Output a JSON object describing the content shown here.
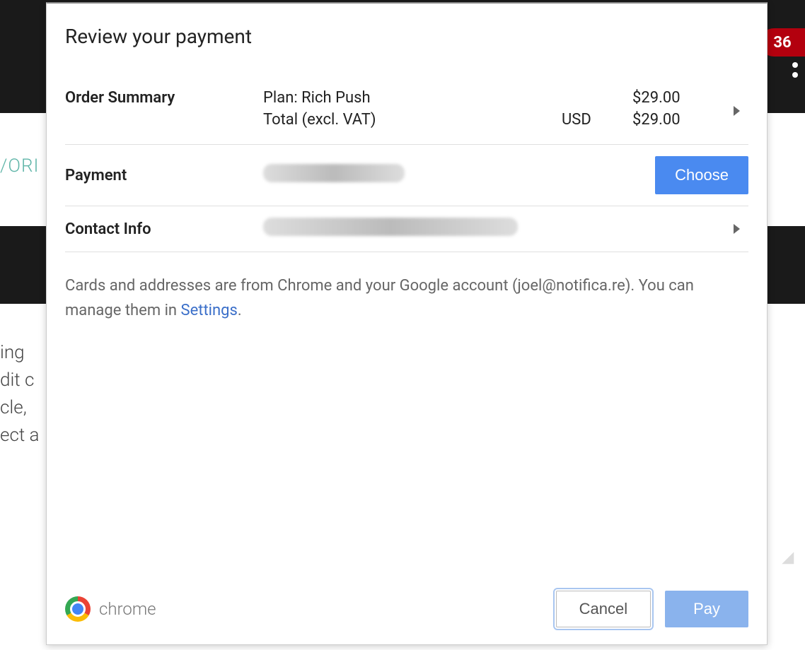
{
  "background": {
    "word_fragment": "/ORI",
    "text_lines": [
      "ing",
      "dit c",
      "cle,",
      "ect a"
    ],
    "badge_count": "36"
  },
  "modal": {
    "title": "Review your payment",
    "order_summary": {
      "label": "Order Summary",
      "rows": [
        {
          "desc": "Plan: Rich Push",
          "currency": "",
          "amount": "$29.00"
        },
        {
          "desc": "Total (excl. VAT)",
          "currency": "USD",
          "amount": "$29.00"
        }
      ]
    },
    "payment": {
      "label": "Payment",
      "choose_label": "Choose"
    },
    "contact": {
      "label": "Contact Info"
    },
    "info": {
      "text_before": "Cards and addresses are from Chrome and your Google account (joel@notifica.re). You can manage them in ",
      "link_label": "Settings",
      "text_after": "."
    },
    "footer": {
      "brand": "chrome",
      "cancel_label": "Cancel",
      "pay_label": "Pay"
    }
  }
}
